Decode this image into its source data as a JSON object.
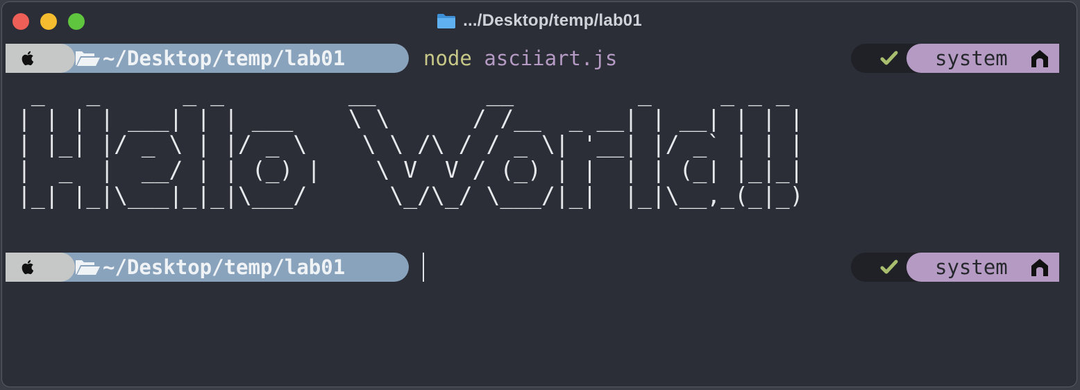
{
  "window": {
    "title": ".../Desktop/temp/lab01",
    "title_icon": "folder-icon"
  },
  "prompt1": {
    "os_icon": "apple-icon",
    "dir_icon": "open-folder-icon",
    "path": "~/Desktop/temp/lab01",
    "command": "node",
    "argument": "asciiart.js",
    "status_icon": "check-icon",
    "context": "system",
    "context_icon": "home-icon"
  },
  "output": {
    "ascii_art": " _   _      _ _         __        __         _     _ _ _ \n| | | | ___| | | ___    \\ \\      / /__  _ __| | __| | | |\n| |_| |/ _ \\ | |/ _ \\    \\ \\ /\\ / / _ \\| '__| |/ _` | | |\n|  _  |  __/ | | (_) |    \\ V  V / (_) | |  | | (_| |_|_|\n|_| |_|\\___|_|_|\\___/      \\_/\\_/ \\___/|_|  |_|\\__,_(_|_)"
  },
  "prompt2": {
    "os_icon": "apple-icon",
    "dir_icon": "open-folder-icon",
    "path": "~/Desktop/temp/lab01",
    "status_icon": "check-icon",
    "context": "system",
    "context_icon": "home-icon"
  },
  "colors": {
    "background": "#2b2e36",
    "path_segment": "#8aa3bc",
    "context_segment": "#b59bc4",
    "command": "#c7c788",
    "argument": "#b59bc4",
    "check": "#a9bd6e"
  }
}
